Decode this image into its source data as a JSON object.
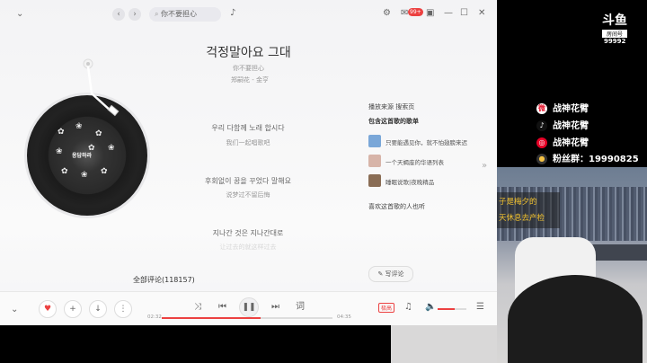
{
  "player": {
    "search_placeholder": "你不要担心",
    "notification_count": "99+",
    "title": "걱정말아요 그대",
    "subtitle": "你不要担心",
    "artist": "郑嗣花 - 金亨",
    "lyrics": [
      {
        "ko": "우리 다함께 노래 합시다",
        "zh": "我们一起唱歌吧"
      },
      {
        "ko": "후회없이 꿈을 꾸었다 말해요",
        "zh": "说梦过不留后悔"
      },
      {
        "ko": "지나간 것은 지나간대로",
        "zh": "让过去的就这样过去"
      }
    ],
    "cover_text": "응답하라",
    "play_source_label": "播放来源  搜索页",
    "contains_label": "包含这首歌的歌单",
    "sheets": [
      {
        "name": "只要能遇见你，就不怕翅膀来迟",
        "color": "#7aa7d8"
      },
      {
        "name": "一个天蝎座的华语列表",
        "color": "#d7b4a8"
      },
      {
        "name": "睡眠说歌|夜晚精品",
        "color": "#8a6d55"
      }
    ],
    "liked_by_label": "喜欢这首歌的人也听",
    "comments_label": "全部评论(118157)",
    "write_comment_label": "写评论",
    "time_current": "02:32",
    "time_total": "04:35",
    "progress": 0.58,
    "lyric_button": "词",
    "quality_badge": "极高",
    "accent": "#ec4141"
  },
  "stream": {
    "platform": "斗鱼",
    "room_label": "房间号",
    "room_number": "99992",
    "socials": [
      {
        "icon": "weibo-icon",
        "label": "战神花臂",
        "color": "#e6162d"
      },
      {
        "icon": "tiktok-icon",
        "label": "战神花臂",
        "color": "#111111"
      },
      {
        "icon": "netease-icon",
        "label": "战神花臂",
        "color": "#e60026"
      },
      {
        "icon": "fans-icon",
        "label": "粉丝群：19990825",
        "color": "#333333"
      }
    ],
    "caption_line1": "子是梅夕的",
    "caption_line2": "天休息去产检"
  }
}
